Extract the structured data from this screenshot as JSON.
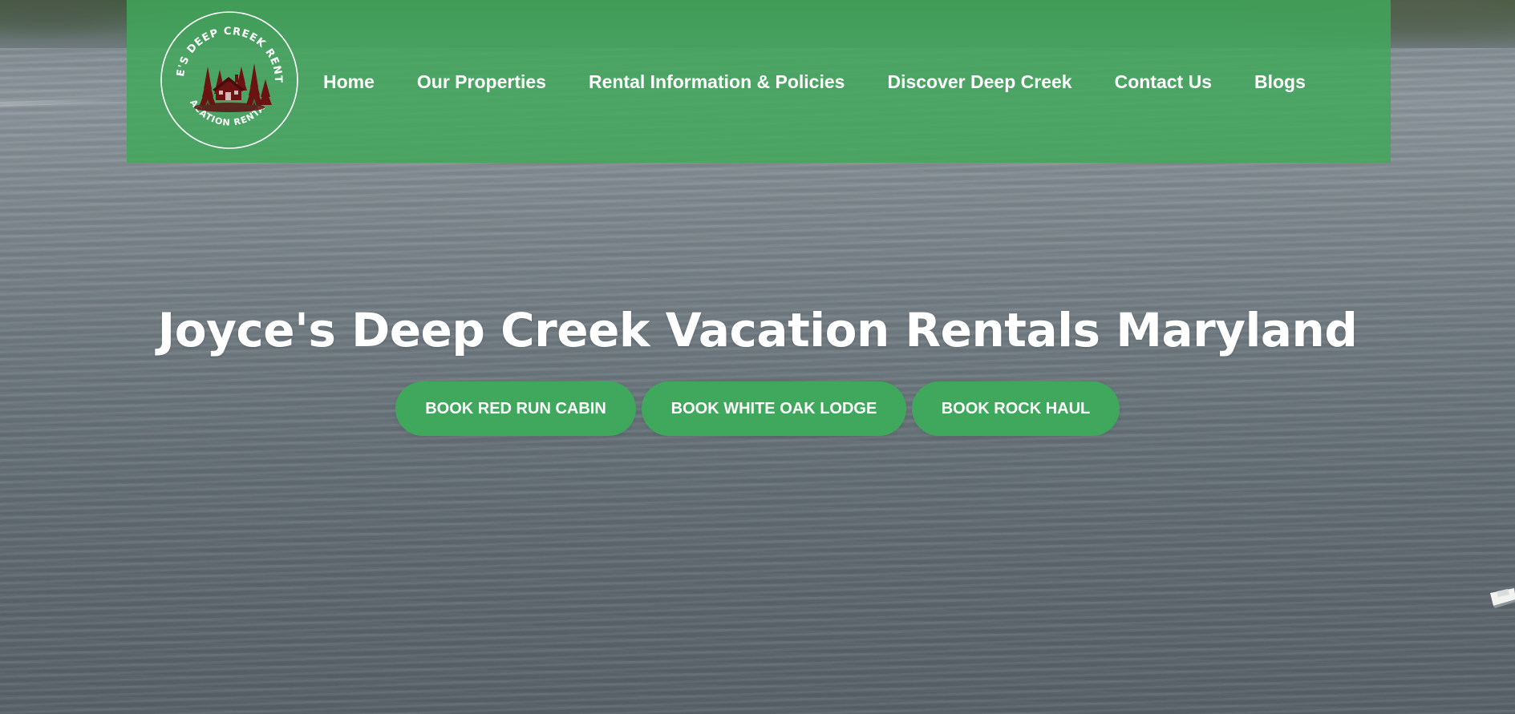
{
  "brand": {
    "logo_text_top": "JOYCE'S DEEP CREEK RENTALS",
    "logo_text_bottom": "VACATION RENTALS",
    "logo_color": "#6b1212"
  },
  "nav": {
    "items": [
      {
        "label": "Home"
      },
      {
        "label": "Our Properties"
      },
      {
        "label": "Rental Information & Policies"
      },
      {
        "label": "Discover Deep Creek"
      },
      {
        "label": "Contact Us"
      },
      {
        "label": "Blogs"
      }
    ]
  },
  "hero": {
    "title": "Joyce's Deep Creek Vacation Rentals Maryland",
    "buttons": [
      {
        "label": "BOOK RED RUN CABIN"
      },
      {
        "label": "BOOK WHITE OAK LODGE"
      },
      {
        "label": "BOOK ROCK HAUL"
      }
    ]
  },
  "colors": {
    "header_green": "#40a85a",
    "button_green": "#3fa85c",
    "text_white": "#ffffff"
  }
}
